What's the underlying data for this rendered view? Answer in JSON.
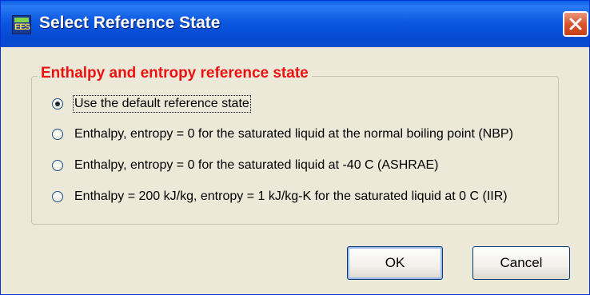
{
  "window": {
    "title": "Select Reference State"
  },
  "group": {
    "legend": "Enthalpy and entropy reference state"
  },
  "options": [
    {
      "label": "Use the default reference state",
      "checked": true
    },
    {
      "label": "Enthalpy, entropy = 0 for the saturated liquid at the normal boiling point (NBP)",
      "checked": false
    },
    {
      "label": "Enthalpy, entropy = 0 for the saturated liquid at -40 C (ASHRAE)",
      "checked": false
    },
    {
      "label": "Enthalpy = 200 kJ/kg, entropy = 1 kJ/kg-K for the saturated liquid at 0 C (IIR)",
      "checked": false
    }
  ],
  "buttons": {
    "ok": "OK",
    "cancel": "Cancel"
  },
  "icons": {
    "app": "ees-app-icon",
    "close": "close-icon"
  }
}
